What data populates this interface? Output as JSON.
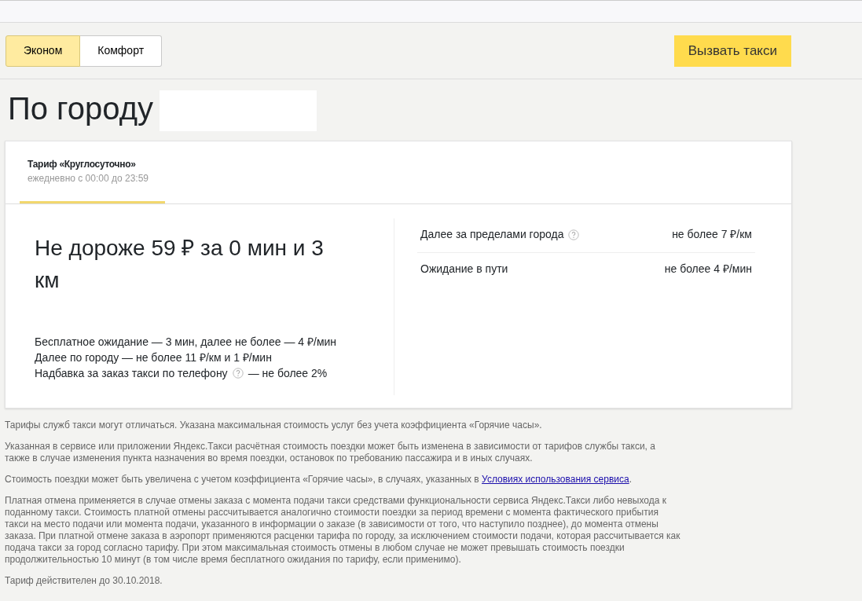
{
  "tariff_tabs": [
    {
      "label": "Эконом",
      "selected": true
    },
    {
      "label": "Комфорт",
      "selected": false
    }
  ],
  "order_button": "Вызвать такси",
  "heading": "По городу",
  "card": {
    "tab": {
      "title": "Тариф «Круглосуточно»",
      "hours": "ежедневно с 00:00 до 23:59",
      "selected": true
    },
    "price": "Не дороже 59 ₽ за 0 мин и 3 км",
    "conditions": [
      {
        "text": "Бесплатное ожидание — 3 мин, далее не более — 4 ₽/мин",
        "help": false
      },
      {
        "text": "Далее по городу — не более 11 ₽/км и 1 ₽/мин",
        "help": false
      },
      {
        "text": "Надбавка за заказ такси по телефону",
        "help": true,
        "after": "— не более 2%"
      }
    ],
    "extras": [
      {
        "label": "Далее за пределами города",
        "help": true,
        "value": "не более 7 ₽/км"
      },
      {
        "label": "Ожидание в пути",
        "help": false,
        "value": "не более 4 ₽/мин"
      }
    ]
  },
  "notes": [
    {
      "text": "Тарифы служб такси могут отличаться. Указана максимальная стоимость услуг без учета коэффициента «Горячие часы»."
    },
    {
      "text": "Указанная в сервисе или приложении Яндекс.Такси расчётная стоимость поездки может быть изменена в зависимости от тарифов службы такси, а также в случае изменения пункта назначения во время поездки, остановок по требованию пассажира и в иных случаях."
    },
    {
      "text": "Стоимость поездки может быть увеличена с учетом коэффициента «Горячие часы», в случаях, указанных в ",
      "link": "Условиях использования сервиса",
      "after": "."
    },
    {
      "text": "Платная отмена применяется в случае отмены заказа с момента подачи такси средствами функциональности сервиса Яндекс.Такси либо невыхода к поданному такси. Стоимость платной отмены рассчитывается аналогично стоимости поездки за период времени с момента фактического прибытия такси на место подачи или момента подачи, указанного в информации о заказе (в зависимости от того, что наступило позднее), до момента отмены заказа. При платной отмене заказа в аэропорт применяются расценки тарифа по городу, за исключением стоимости подачи, которая рассчитывается как подача такси за город согласно тарифу. При этом максимальная стоимость отмены в любом случае не может превышать стоимость поездки продолжительностью 10 минут (в том числе время бесплатного ожидания по тарифу, если применимо)."
    },
    {
      "text": "Тариф действителен до 30.10.2018."
    }
  ]
}
